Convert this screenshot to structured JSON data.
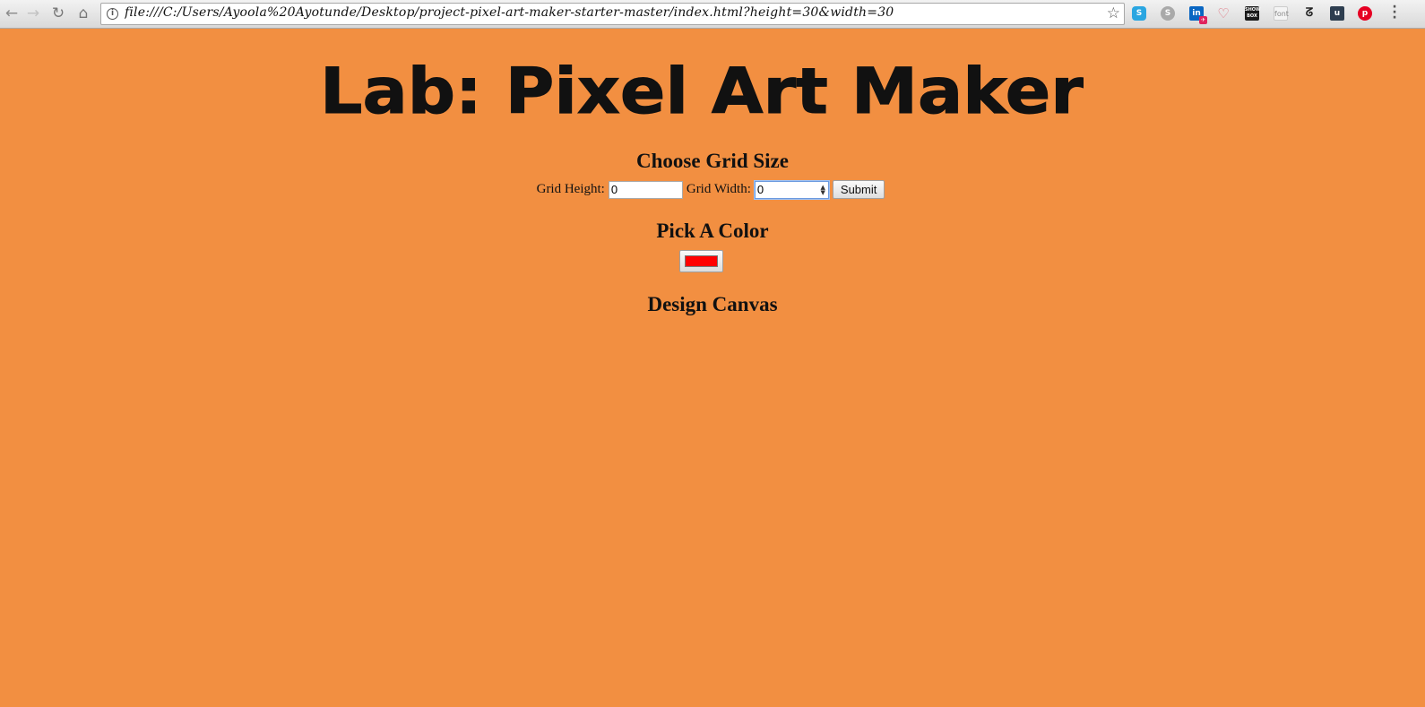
{
  "browser": {
    "url": "file:///C:/Users/Ayoola%20Ayotunde/Desktop/project-pixel-art-maker-starter-master/index.html?height=30&width=30",
    "extensions": {
      "skype": "S",
      "skype_gray": "S",
      "linkedin": "in",
      "showbox": "SHOW BOX",
      "font": "font",
      "pocket": "u",
      "pinterest": "p"
    }
  },
  "page": {
    "banner_title": "Lab: Pixel Art Maker",
    "grid_section_title": "Choose Grid Size",
    "grid_height_label": "Grid Height:",
    "grid_height_value": "0",
    "grid_width_label": "Grid Width:",
    "grid_width_value": "0",
    "submit_label": "Submit",
    "color_section_title": "Pick A Color",
    "selected_color": "#ff0000",
    "canvas_section_title": "Design Canvas"
  },
  "colors": {
    "background": "#f28f41",
    "title_text": "#111111"
  }
}
